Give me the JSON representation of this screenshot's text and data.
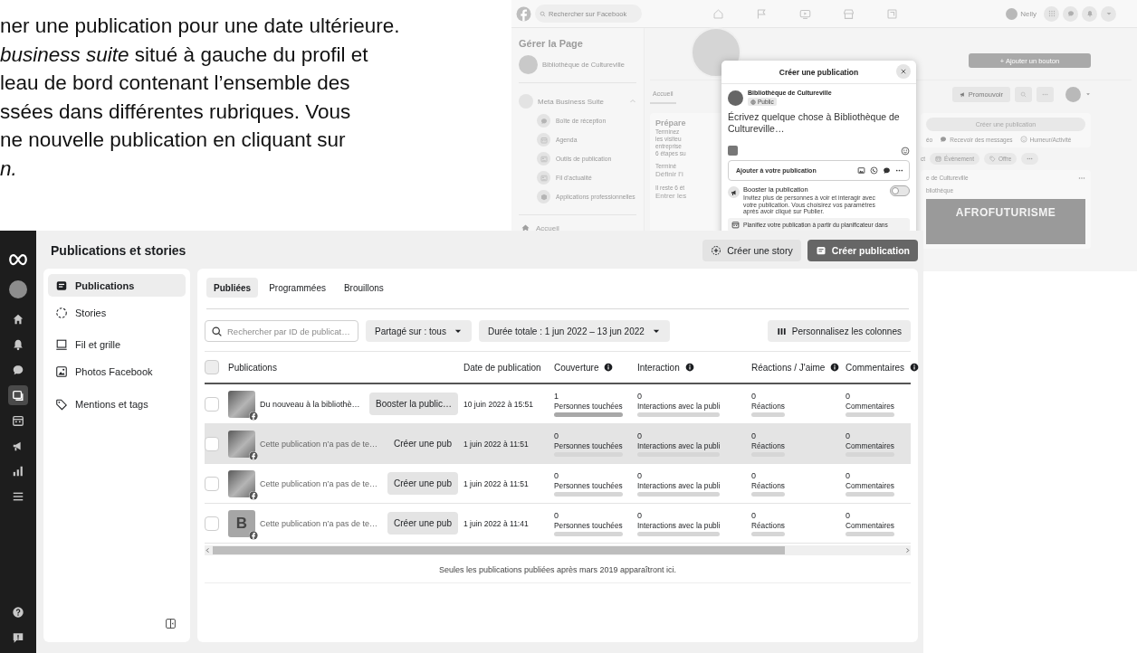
{
  "article": {
    "lines": [
      {
        "text": "ner une publication pour une date ultérieure.",
        "italic": false
      },
      {
        "text": "*business suite* situé à gauche du profil et",
        "italic": false
      },
      {
        "text": "leau de bord contenant l’ensemble des",
        "italic": false
      },
      {
        "text": "ssées dans différentes rubriques. Vous",
        "italic": false
      },
      {
        "text": "ne nouvelle publication en cliquant sur",
        "italic": false
      },
      {
        "text": "n.",
        "italic": true
      }
    ]
  },
  "facebook_page": {
    "topbar": {
      "search_placeholder": "Rechercher sur Facebook",
      "user_name": "Nelly"
    },
    "sidebar": {
      "title": "Gérer la Page",
      "page_name": "Bibliothèque de Cultureville",
      "section": {
        "label": "Meta Business Suite",
        "expanded": true
      },
      "items": [
        "Boîte de réception",
        "Agenda",
        "Outils de publication",
        "Fil d’actualité",
        "Applications professionnelles"
      ],
      "home": "Accueil"
    },
    "center": {
      "tab": "Accueil",
      "card_title": "Prépare",
      "texts": [
        "Terminez",
        "les visiteu",
        "entreprise",
        "6 étapes su"
      ],
      "steps": [
        {
          "status": "Terminé",
          "label": "Définir l’i"
        },
        {
          "status": "Il reste 6 ét",
          "label": "Entrer les"
        }
      ]
    },
    "right": {
      "add_button": "+ Ajouter un bouton",
      "promote": "Promouvoir",
      "create_post": "Créer une publication",
      "actions": [
        "éo",
        "Recevoir des messages",
        "Humeur/Activité"
      ],
      "chips": [
        "ct",
        "Évènement",
        "Offre"
      ],
      "post": {
        "author": "e de Cultureville",
        "subtitle": "bliothèque"
      },
      "image_text": "AFROFUTURISME"
    },
    "modal": {
      "title": "Créer une publication",
      "author": "Bibliothèque de Cultureville",
      "audience": "Public",
      "prompt": "Écrivez quelque chose à Bibliothèque de Cultureville…",
      "add_label": "Ajouter à votre publication",
      "boost": {
        "title": "Booster la publication",
        "description": "Invitez plus de personnes à voir et interagir avec votre publication. Vous choisirez vos paramètres après avoir cliqué sur Publier.",
        "on": false
      },
      "schedule": "Planifiez votre publication à partir du planificateur dans"
    }
  },
  "business_suite": {
    "rail": {
      "top": [
        {
          "selected": false
        },
        {
          "selected": false
        },
        {
          "selected": false
        },
        {
          "selected": false
        },
        {
          "selected": false
        },
        {
          "selected": true
        },
        {
          "selected": false
        },
        {
          "selected": false
        },
        {
          "selected": false
        },
        {
          "selected": false
        }
      ],
      "bottom": [
        {
          "selected": false
        },
        {
          "selected": false
        }
      ]
    },
    "header": {
      "title": "Publications et stories",
      "buttons": [
        {
          "label": "Créer une story",
          "kind": "secondary"
        },
        {
          "label": "Créer publication",
          "kind": "primary"
        }
      ]
    },
    "nav": [
      {
        "label": "Publications",
        "selected": true
      },
      {
        "label": "Stories",
        "selected": false
      },
      {
        "label": "Fil et grille",
        "selected": false
      },
      {
        "label": "Photos Facebook",
        "selected": false
      },
      {
        "label": "Mentions et tags",
        "selected": false
      }
    ],
    "tabs": [
      {
        "label": "Publiées",
        "selected": true
      },
      {
        "label": "Programmées",
        "selected": false
      },
      {
        "label": "Brouillons",
        "selected": false
      }
    ],
    "filters": {
      "search_placeholder": "Rechercher par ID de publicat…",
      "dropdowns": [
        "Partagé sur : tous",
        "Durée totale : 1 jun 2022 – 13 jun 2022"
      ],
      "columns_button": "Personnalisez les colonnes"
    },
    "table": {
      "all_checked": false,
      "columns": [
        {
          "label": "Publications",
          "info": false
        },
        {
          "label": "Date de publication",
          "info": false
        },
        {
          "label": "Couverture",
          "info": true
        },
        {
          "label": "Interaction",
          "info": true
        },
        {
          "label": "Réactions / J'aime",
          "info": true
        },
        {
          "label": "Commentaires",
          "info": true
        }
      ],
      "rows": [
        {
          "checked": false,
          "hovered": false,
          "thumbnail": {
            "kind": "photo"
          },
          "text": "Du nouveau à la bibliothè…",
          "muted": false,
          "action": "Booster la public…",
          "date": "10 juin 2022 à 15:51",
          "metrics": [
            {
              "value": "1",
              "label": "Personnes touchées",
              "level": 1
            },
            {
              "value": "0",
              "label": "Interactions avec la publi",
              "level": 0
            },
            {
              "value": "0",
              "label": "Réactions",
              "level": 0
            },
            {
              "value": "0",
              "label": "Commentaires",
              "level": 0
            }
          ]
        },
        {
          "checked": false,
          "hovered": true,
          "thumbnail": {
            "kind": "photo"
          },
          "text": "Cette publication n’a pas de te…",
          "muted": true,
          "action": "Créer une pub",
          "date": "1 juin 2022 à 11:51",
          "metrics": [
            {
              "value": "0",
              "label": "Personnes touchées",
              "level": 0
            },
            {
              "value": "0",
              "label": "Interactions avec la publi",
              "level": 0
            },
            {
              "value": "0",
              "label": "Réactions",
              "level": 0
            },
            {
              "value": "0",
              "label": "Commentaires",
              "level": 0
            }
          ]
        },
        {
          "checked": false,
          "hovered": false,
          "thumbnail": {
            "kind": "photo"
          },
          "text": "Cette publication n’a pas de te…",
          "muted": true,
          "action": "Créer une pub",
          "date": "1 juin 2022 à 11:51",
          "metrics": [
            {
              "value": "0",
              "label": "Personnes touchées",
              "level": 0
            },
            {
              "value": "0",
              "label": "Interactions avec la publi",
              "level": 0
            },
            {
              "value": "0",
              "label": "Réactions",
              "level": 0
            },
            {
              "value": "0",
              "label": "Commentaires",
              "level": 0
            }
          ]
        },
        {
          "checked": false,
          "hovered": false,
          "thumbnail": {
            "kind": "letter",
            "letter": "B"
          },
          "text": "Cette publication n’a pas de te…",
          "muted": true,
          "action": "Créer une pub",
          "date": "1 juin 2022 à 11:41",
          "metrics": [
            {
              "value": "0",
              "label": "Personnes touchées",
              "level": 0
            },
            {
              "value": "0",
              "label": "Interactions avec la publi",
              "level": 0
            },
            {
              "value": "0",
              "label": "Réactions",
              "level": 0
            },
            {
              "value": "0",
              "label": "Commentaires",
              "level": 0
            }
          ]
        }
      ]
    },
    "footer_note": "Seules les publications publiées après mars 2019 apparaîtront ici."
  }
}
